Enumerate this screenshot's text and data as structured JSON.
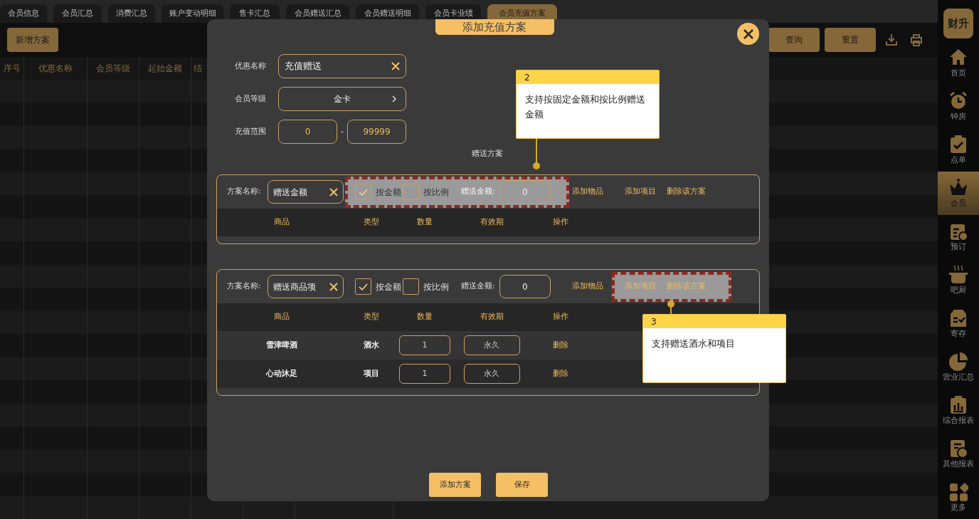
{
  "tabs": [
    {
      "label": "会员信息",
      "selected": false
    },
    {
      "label": "会员汇总",
      "selected": false
    },
    {
      "label": "消费汇总",
      "selected": false
    },
    {
      "label": "账户变动明细",
      "selected": false
    },
    {
      "label": "售卡汇总",
      "selected": false
    },
    {
      "label": "会员赠送汇总",
      "selected": false
    },
    {
      "label": "会员赠送明细",
      "selected": false
    },
    {
      "label": "会员卡业绩",
      "selected": false
    },
    {
      "label": "会员充值方案",
      "selected": true
    }
  ],
  "toolbar": {
    "add_button": "新增方案",
    "query_button": "查询",
    "reset_button": "重置"
  },
  "table": {
    "columns": [
      "序号",
      "优惠名称",
      "会员等级",
      "起始金额",
      "结"
    ]
  },
  "sidebar": {
    "logo": "财升",
    "items": [
      {
        "label": "首页",
        "selected": false
      },
      {
        "label": "钟房",
        "selected": false
      },
      {
        "label": "点单",
        "selected": false
      },
      {
        "label": "会员",
        "selected": true
      },
      {
        "label": "预订",
        "selected": false
      },
      {
        "label": "吧厨",
        "selected": false
      },
      {
        "label": "寄存",
        "selected": false
      },
      {
        "label": "营业汇总",
        "selected": false
      },
      {
        "label": "综合报表",
        "selected": false
      },
      {
        "label": "其他报表",
        "selected": false
      },
      {
        "label": "更多",
        "selected": false
      }
    ]
  },
  "dialog": {
    "title": "添加充值方案",
    "form": {
      "discount_name_label": "优惠名称",
      "discount_name": "充值赠送",
      "member_level_label": "会员等级",
      "member_level": "金卡",
      "range_label": "充值范围",
      "range_min": "0",
      "range_separator": "-",
      "range_max": "99999"
    },
    "section_title": "赠送方案",
    "plans": [
      {
        "name_label": "方案名称:",
        "name": "赠送金额",
        "by_amount": {
          "label": "按金额",
          "checked": true
        },
        "by_ratio": {
          "label": "按比例",
          "checked": false
        },
        "gift_amount_label": "赠送金额:",
        "gift_amount": "0",
        "actions": [
          "添加物品",
          "添加项目",
          "删除该方案"
        ],
        "options_highlighted": true,
        "actions_highlighted": false,
        "columns": [
          "商品",
          "类型",
          "数量",
          "有效期",
          "操作"
        ]
      },
      {
        "name_label": "方案名称:",
        "name": "赠送商品项",
        "by_amount": {
          "label": "按金额",
          "checked": true
        },
        "by_ratio": {
          "label": "按比例",
          "checked": false
        },
        "gift_amount_label": "赠送金额:",
        "gift_amount": "0",
        "actions": [
          "添加物品",
          "添加项目",
          "删除该方案"
        ],
        "options_highlighted": false,
        "actions_highlighted": true,
        "columns": [
          "商品",
          "类型",
          "数量",
          "有效期",
          "操作"
        ],
        "rows": [
          {
            "goods": "雪津啤酒",
            "type": "酒水",
            "quantity": "1",
            "validity": "永久",
            "action": "删除"
          },
          {
            "goods": "心动沐足",
            "type": "项目",
            "quantity": "1",
            "validity": "永久",
            "action": "删除"
          }
        ]
      }
    ],
    "buttons": [
      "添加方案",
      "保存"
    ]
  },
  "callouts": [
    {
      "number": "2",
      "text": "支持按固定金额和按比例赠送金额"
    },
    {
      "number": "3",
      "text": "支持赠送酒水和项目"
    }
  ]
}
